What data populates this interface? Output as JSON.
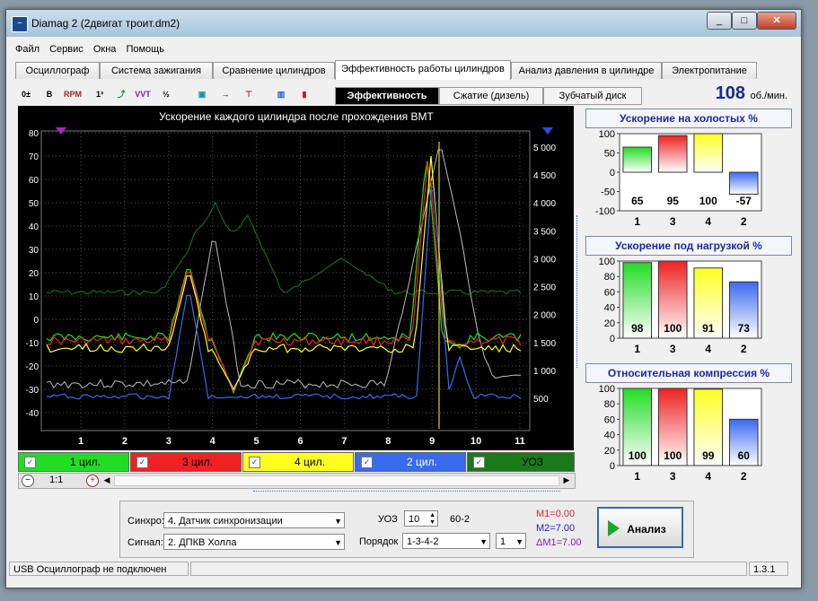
{
  "window": {
    "title": "Diamag 2 (2двигат троит.dm2)"
  },
  "menu": [
    "Файл",
    "Сервис",
    "Окна",
    "Помощь"
  ],
  "tabs": [
    {
      "label": "Осциллограф"
    },
    {
      "label": "Система зажигания"
    },
    {
      "label": "Сравнение цилиндров"
    },
    {
      "label": "Эффективность работы цилиндров",
      "active": true
    },
    {
      "label": "Анализ давления в цилиндре"
    },
    {
      "label": "Электропитание"
    }
  ],
  "subtabs": [
    {
      "label": "Эффективность",
      "active": true
    },
    {
      "label": "Сжатие (дизель)"
    },
    {
      "label": "Зубчатый диск"
    }
  ],
  "rpm": {
    "value": "108",
    "unit": "об./мин."
  },
  "scope": {
    "title": "Ускорение каждого цилиндра после прохождения ВМТ",
    "left_ticks": [
      "80",
      "70",
      "60",
      "50",
      "40",
      "30",
      "20",
      "10",
      "0",
      "-10",
      "-20",
      "-30",
      "-40"
    ],
    "right_ticks": [
      "5 000",
      "4 500",
      "4 000",
      "3 500",
      "3 000",
      "2 500",
      "2 000",
      "1 500",
      "1 000",
      "500"
    ],
    "x_ticks": [
      "1",
      "2",
      "3",
      "4",
      "5",
      "6",
      "7",
      "8",
      "9",
      "10",
      "11"
    ]
  },
  "legend": [
    {
      "label": "1 цил.",
      "color": "#22dd22"
    },
    {
      "label": "3 цил.",
      "color": "#ee2222"
    },
    {
      "label": "4 цил.",
      "color": "#ffff22"
    },
    {
      "label": "2 цил.",
      "color": "#3a6aee"
    },
    {
      "label": "УОЗ",
      "color": "#1a7a1a"
    }
  ],
  "zoom": {
    "scale": "1:1"
  },
  "chart_data": [
    {
      "type": "bar",
      "title": "Ускорение на холостых %",
      "categories": [
        "1",
        "3",
        "4",
        "2"
      ],
      "values": [
        65,
        95,
        100,
        -57
      ],
      "ylim": [
        -100,
        100
      ],
      "yticks": [
        "100",
        "50",
        "0",
        "-50",
        "-100"
      ],
      "colors": [
        "#22dd22",
        "#ee2222",
        "#ffff22",
        "#3a6aee"
      ]
    },
    {
      "type": "bar",
      "title": "Ускорение под нагрузкой %",
      "categories": [
        "1",
        "3",
        "4",
        "2"
      ],
      "values": [
        98,
        100,
        91,
        73
      ],
      "ylim": [
        0,
        100
      ],
      "yticks": [
        "100",
        "80",
        "60",
        "40",
        "20",
        "0"
      ],
      "colors": [
        "#22dd22",
        "#ee2222",
        "#ffff22",
        "#3a6aee"
      ]
    },
    {
      "type": "bar",
      "title": "Относительная компрессия %",
      "categories": [
        "1",
        "3",
        "4",
        "2"
      ],
      "values": [
        100,
        100,
        99,
        60
      ],
      "ylim": [
        0,
        100
      ],
      "yticks": [
        "100",
        "80",
        "60",
        "40",
        "20",
        "0"
      ],
      "colors": [
        "#22dd22",
        "#ee2222",
        "#ffff22",
        "#3a6aee"
      ]
    }
  ],
  "controls": {
    "sync_label": "Синхро:",
    "sync_value": "4. Датчик синхронизации",
    "signal_label": "Сигнал:",
    "signal_value": "2. ДПКВ Холла",
    "uoz_label": "УОЗ",
    "uoz_value": "10",
    "teeth": "60-2",
    "order_label": "Порядок",
    "order_value": "1-3-4-2",
    "order_index": "1",
    "m1": "M1=0.00",
    "m2": "M2=7.00",
    "dm1": "ΔM1=7.00",
    "analyze_label": "Анализ"
  },
  "status": {
    "text": "USB Осциллограф не подключен",
    "version": "1.3.1"
  }
}
